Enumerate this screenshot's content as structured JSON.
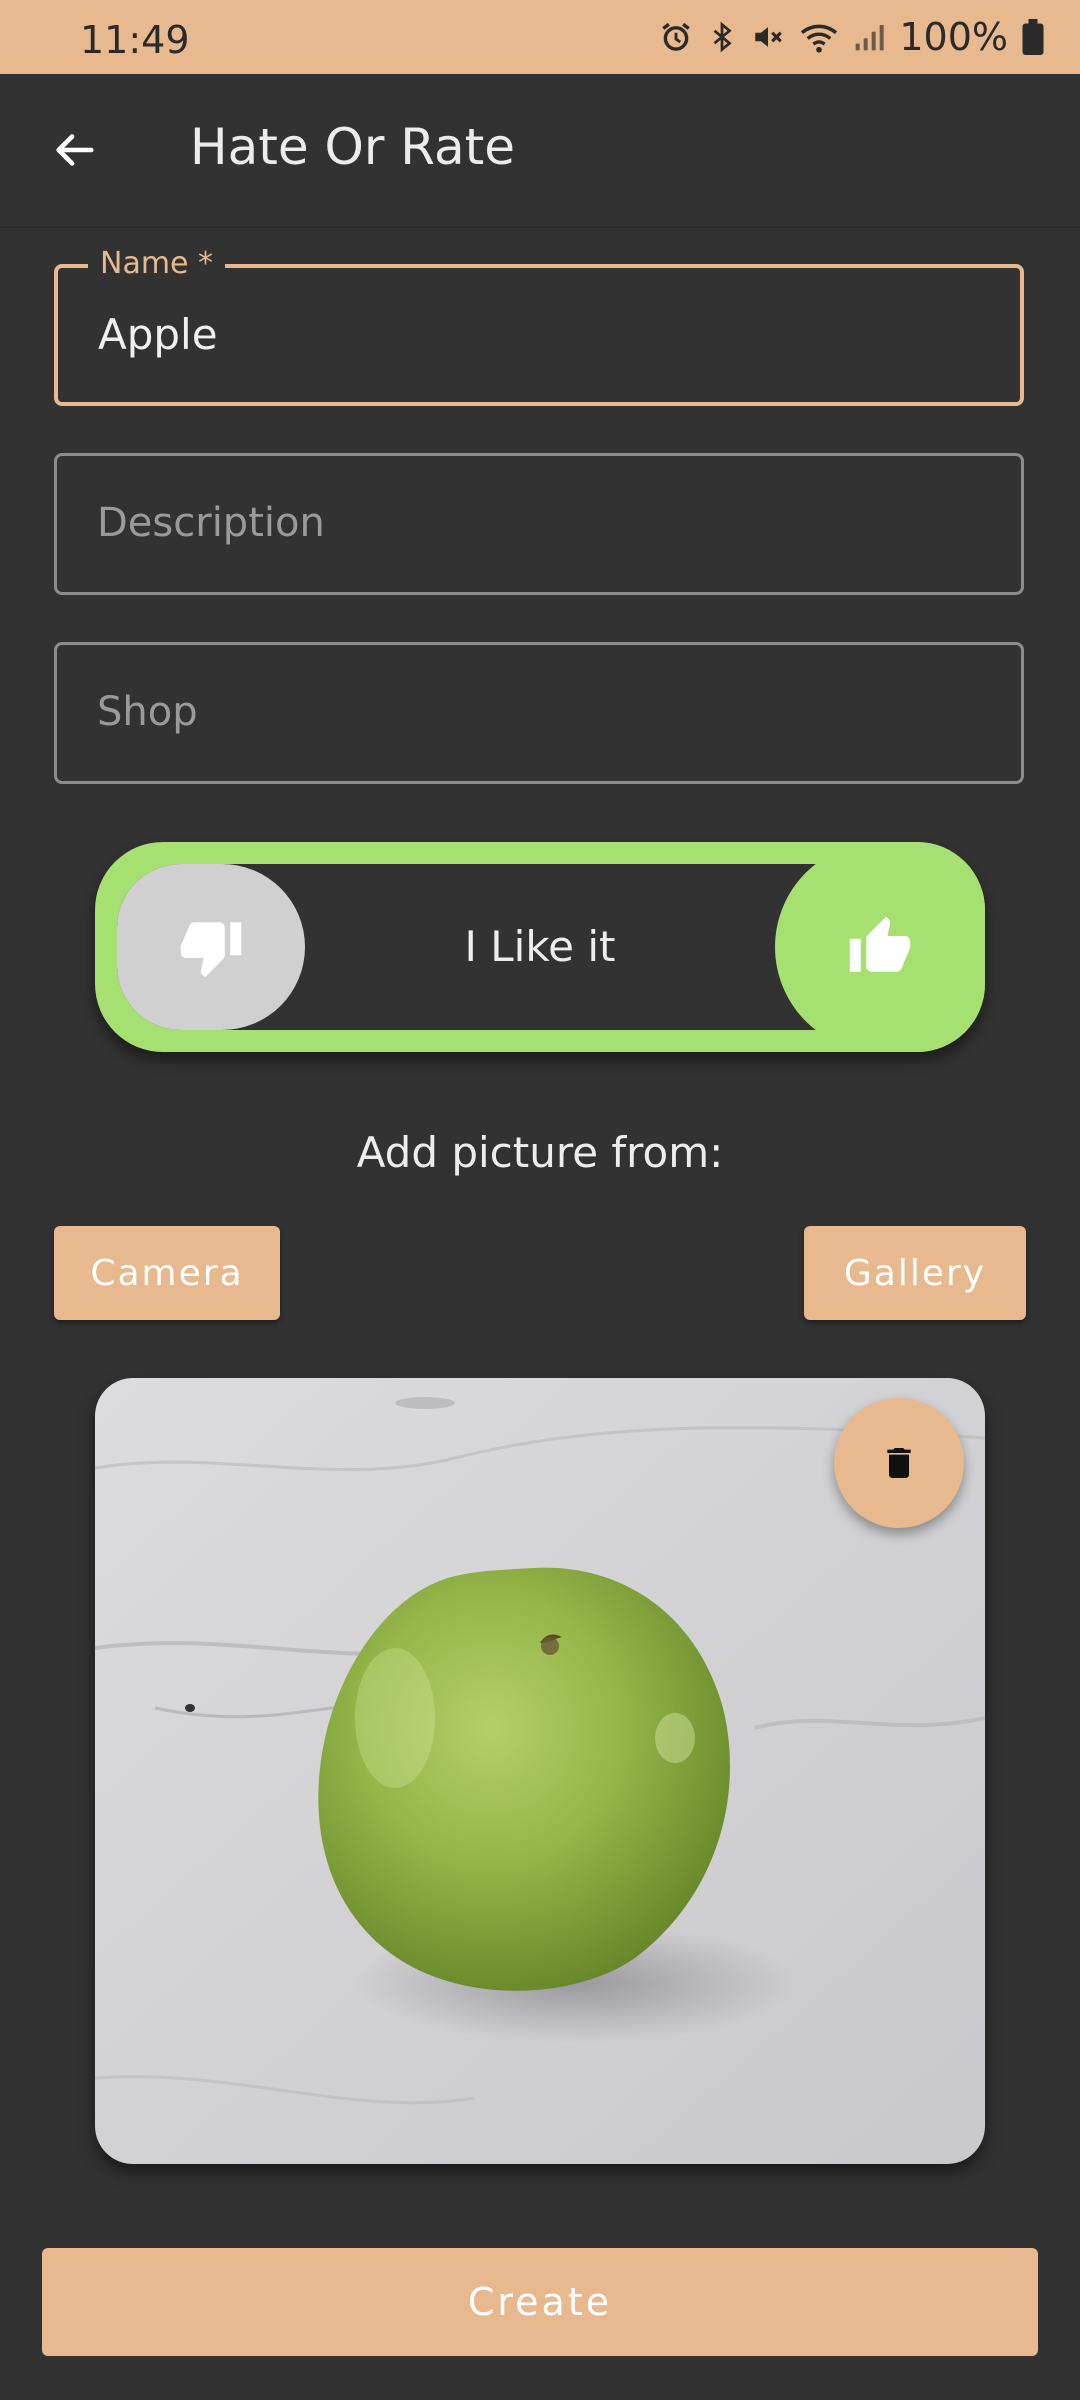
{
  "status_bar": {
    "time": "11:49",
    "battery": "100%",
    "icons": [
      "alarm-icon",
      "bluetooth-icon",
      "mute-icon",
      "wifi-icon",
      "signal-icon",
      "battery-icon"
    ]
  },
  "app_bar": {
    "back_icon": "arrow-left-icon",
    "title": "Hate Or Rate"
  },
  "form": {
    "name": {
      "label": "Name *",
      "value": "Apple"
    },
    "description": {
      "placeholder": "Description",
      "value": ""
    },
    "shop": {
      "placeholder": "Shop",
      "value": ""
    }
  },
  "rating_toggle": {
    "label": "I Like it",
    "left_icon": "thumbs-down-icon",
    "thumb_icon": "thumbs-up-icon",
    "state": "like"
  },
  "picture": {
    "prompt": "Add picture from:",
    "camera_label": "Camera",
    "gallery_label": "Gallery",
    "delete_icon": "trash-icon"
  },
  "create_label": "Create",
  "colors": {
    "accent": "#e8b88e",
    "background": "#323232",
    "like_green": "#a6e070",
    "dislike_gray": "#d0d0d0"
  }
}
